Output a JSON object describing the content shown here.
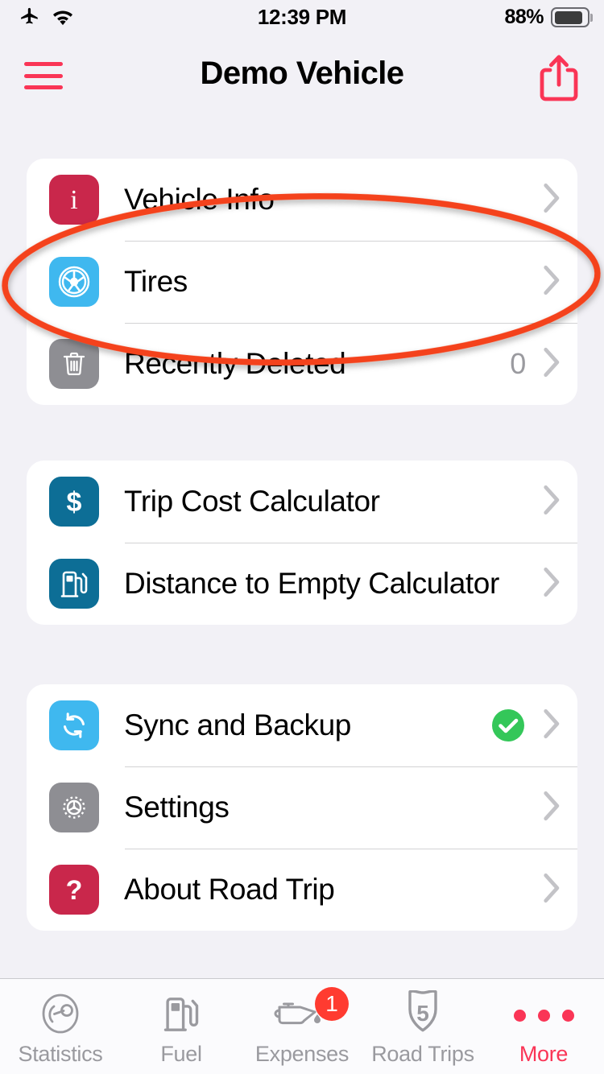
{
  "status_bar": {
    "airplane_icon": "airplane-icon",
    "wifi_icon": "wifi-icon",
    "time": "12:39 PM",
    "battery_percent": "88%",
    "battery_level": 88
  },
  "nav_bar": {
    "menu_icon": "hamburger-menu-icon",
    "title": "Demo Vehicle",
    "share_icon": "share-icon",
    "accent_color": "#fa3556"
  },
  "sections": [
    {
      "id": "vehicle-section",
      "rows": [
        {
          "id": "vehicle-info",
          "label": "Vehicle Info",
          "icon": "info-icon",
          "icon_color": "#c9274b",
          "value": "",
          "check": false
        },
        {
          "id": "tires",
          "label": "Tires",
          "icon": "tire-icon",
          "icon_color": "#3fb8ef",
          "value": "",
          "check": false
        },
        {
          "id": "recently-deleted",
          "label": "Recently Deleted",
          "icon": "trash-icon",
          "icon_color": "#8e8e93",
          "value": "0",
          "check": false
        }
      ]
    },
    {
      "id": "calculators-section",
      "rows": [
        {
          "id": "trip-cost-calculator",
          "label": "Trip Cost Calculator",
          "icon": "dollar-icon",
          "icon_color": "#0d6e96",
          "value": "",
          "check": false
        },
        {
          "id": "distance-to-empty-calculator",
          "label": "Distance to Empty Calculator",
          "icon": "fuel-pump-icon",
          "icon_color": "#0d6e96",
          "value": "",
          "check": false
        }
      ]
    },
    {
      "id": "app-section",
      "rows": [
        {
          "id": "sync-and-backup",
          "label": "Sync and Backup",
          "icon": "sync-icon",
          "icon_color": "#3fb8ef",
          "value": "",
          "check": true
        },
        {
          "id": "settings",
          "label": "Settings",
          "icon": "gear-icon",
          "icon_color": "#8e8e93",
          "value": "",
          "check": false
        },
        {
          "id": "about-road-trip",
          "label": "About Road Trip",
          "icon": "question-icon",
          "icon_color": "#c9274b",
          "value": "",
          "check": false
        }
      ]
    }
  ],
  "annotation": {
    "shape": "ellipse",
    "color": "#f4421a",
    "target": "Tires",
    "stroke_width": 7
  },
  "status_colors": {
    "success": "#34c759",
    "badge": "#ff3b30"
  },
  "tab_bar": {
    "tabs": [
      {
        "id": "statistics",
        "label": "Statistics",
        "icon": "speedometer-icon",
        "badge": "",
        "active": false
      },
      {
        "id": "fuel",
        "label": "Fuel",
        "icon": "fuel-pump-icon",
        "badge": "",
        "active": false
      },
      {
        "id": "expenses",
        "label": "Expenses",
        "icon": "oil-can-icon",
        "badge": "1",
        "active": false
      },
      {
        "id": "road-trips",
        "label": "Road Trips",
        "icon": "highway-shield-5-icon",
        "badge": "",
        "active": false
      },
      {
        "id": "more",
        "label": "More",
        "icon": "ellipsis-icon",
        "badge": "",
        "active": true
      }
    ]
  }
}
